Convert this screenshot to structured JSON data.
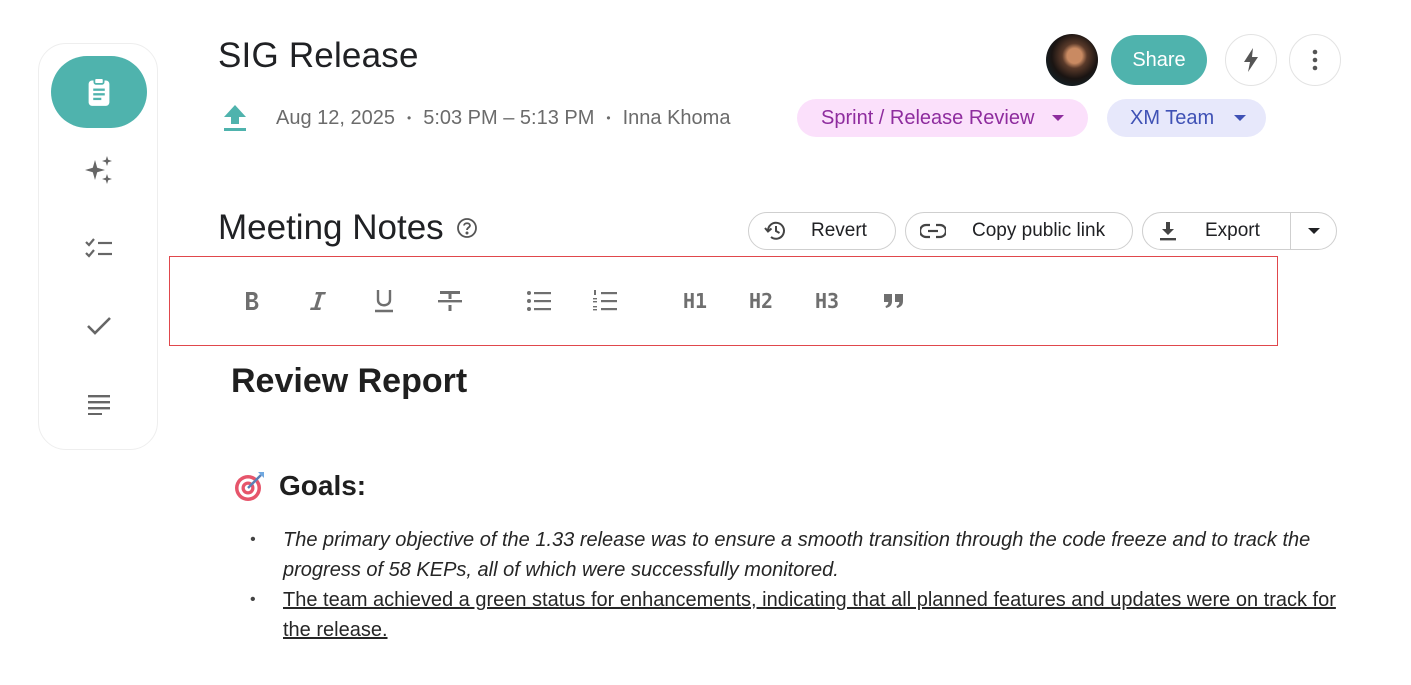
{
  "sidebar": {
    "items": [
      {
        "name": "notes",
        "icon": "clipboard-icon",
        "active": true
      },
      {
        "name": "ai",
        "icon": "sparkles-icon"
      },
      {
        "name": "checklist",
        "icon": "checklist-icon"
      },
      {
        "name": "done",
        "icon": "checkmark-icon"
      },
      {
        "name": "transcript",
        "icon": "lines-icon"
      }
    ]
  },
  "header": {
    "title": "SIG Release",
    "date": "Aug 12, 2025",
    "time": "5:03 PM – 5:13 PM",
    "author": "Inna Khoma",
    "separator": "•",
    "category_chip": "Sprint / Release Review",
    "team_chip": "XM Team",
    "share_label": "Share"
  },
  "notes_header": {
    "title": "Meeting Notes",
    "revert_label": "Revert",
    "copy_link_label": "Copy public link",
    "export_label": "Export"
  },
  "toolbar": {
    "h1": "H1",
    "h2": "H2",
    "h3": "H3"
  },
  "document": {
    "heading": "Review Report",
    "section_title": "Goals:",
    "bullets": [
      "The primary objective of the 1.33 release was to ensure a smooth transition through the code freeze and to track the progress of 58 KEPs, all of which were successfully monitored.",
      "The team achieved a green status for enhancements, indicating that all planned features and updates were on track for the release."
    ]
  },
  "colors": {
    "accent": "#4fb3ad",
    "sprint_chip_bg": "#fbe0fb",
    "sprint_chip_text": "#8e2c9e",
    "team_chip_bg": "#e7e8fb",
    "team_chip_text": "#3f51b5",
    "toolbar_border": "#e0474c"
  }
}
